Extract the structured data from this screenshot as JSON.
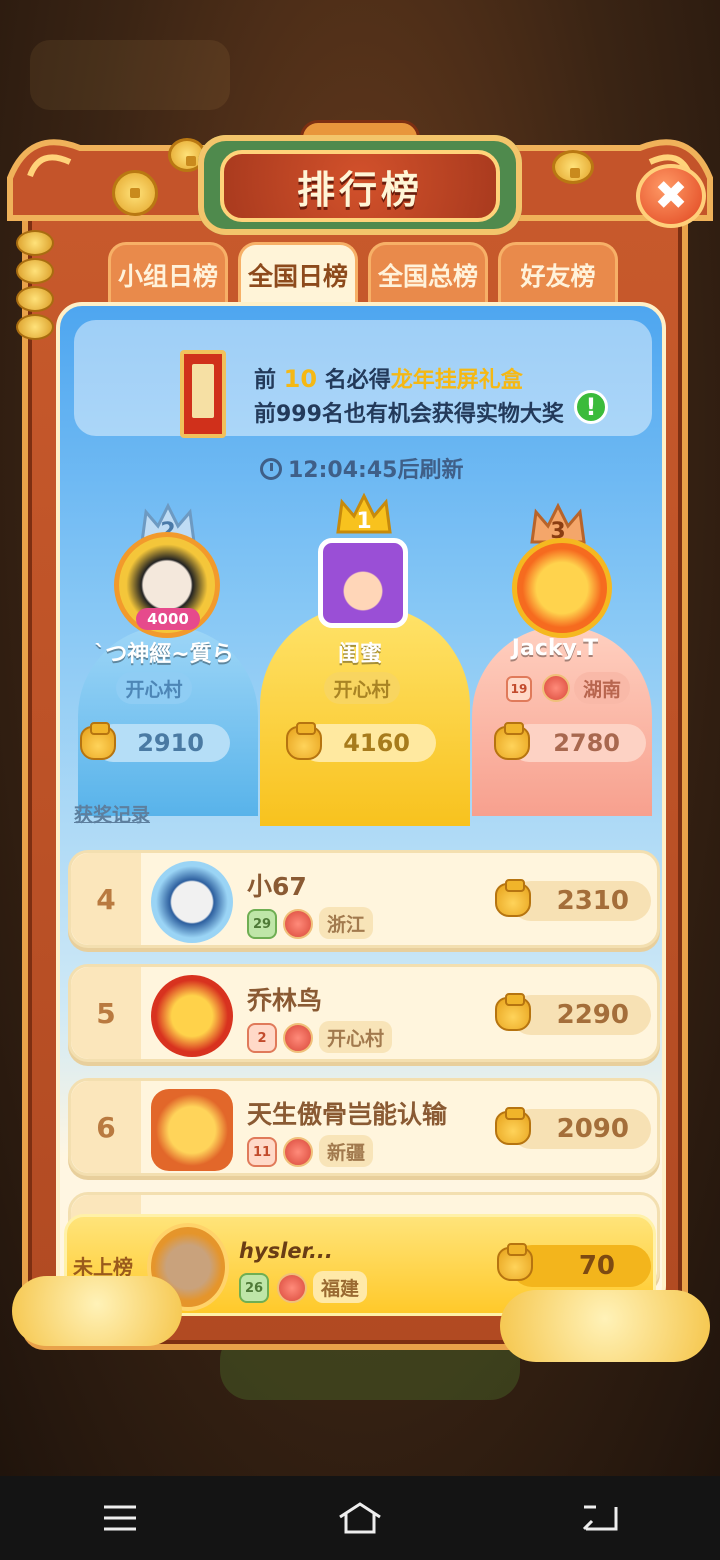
{
  "header": {
    "title": "排行榜",
    "close_label": "✖"
  },
  "tabs": [
    {
      "label": "小组日榜",
      "active": false
    },
    {
      "label": "全国日榜",
      "active": true
    },
    {
      "label": "全国总榜",
      "active": false
    },
    {
      "label": "好友榜",
      "active": false
    }
  ],
  "banner": {
    "line1_prefix": "前 ",
    "line1_num": "10",
    "line1_mid": " 名必得",
    "line1_gift": "龙年挂屏礼盒",
    "line2": "前999名也有机会获得实物大奖",
    "info_icon": "!"
  },
  "refresh": {
    "time": "12:04:45",
    "suffix": "后刷新"
  },
  "top3": [
    {
      "rank": "1",
      "name": "闺蜜",
      "region": "开心村",
      "score": "4160"
    },
    {
      "rank": "2",
      "name": "`つ神經~質ら",
      "region": "开心村",
      "score": "2910",
      "badge": "4000"
    },
    {
      "rank": "3",
      "name": "Jacky.T",
      "level": "19",
      "region": "湖南",
      "score": "2780"
    }
  ],
  "award_link": "获奖记录",
  "rows": [
    {
      "rank": "4",
      "name": "小67",
      "level": "29",
      "region": "浙江",
      "score": "2310"
    },
    {
      "rank": "5",
      "name": "乔林鸟",
      "level": "2",
      "region": "开心村",
      "score": "2290"
    },
    {
      "rank": "6",
      "name": "天生傲骨岂能认输",
      "level": "11",
      "region": "新疆",
      "score": "2090"
    }
  ],
  "self": {
    "rank_label": "未上榜",
    "name": "hysler...",
    "level": "26",
    "region": "福建",
    "score": "70"
  },
  "colors": {
    "frame": "#c85a2c",
    "gold": "#ffd37a",
    "panel_top": "#4ea6f0",
    "row_bg": "#fff5dd"
  }
}
